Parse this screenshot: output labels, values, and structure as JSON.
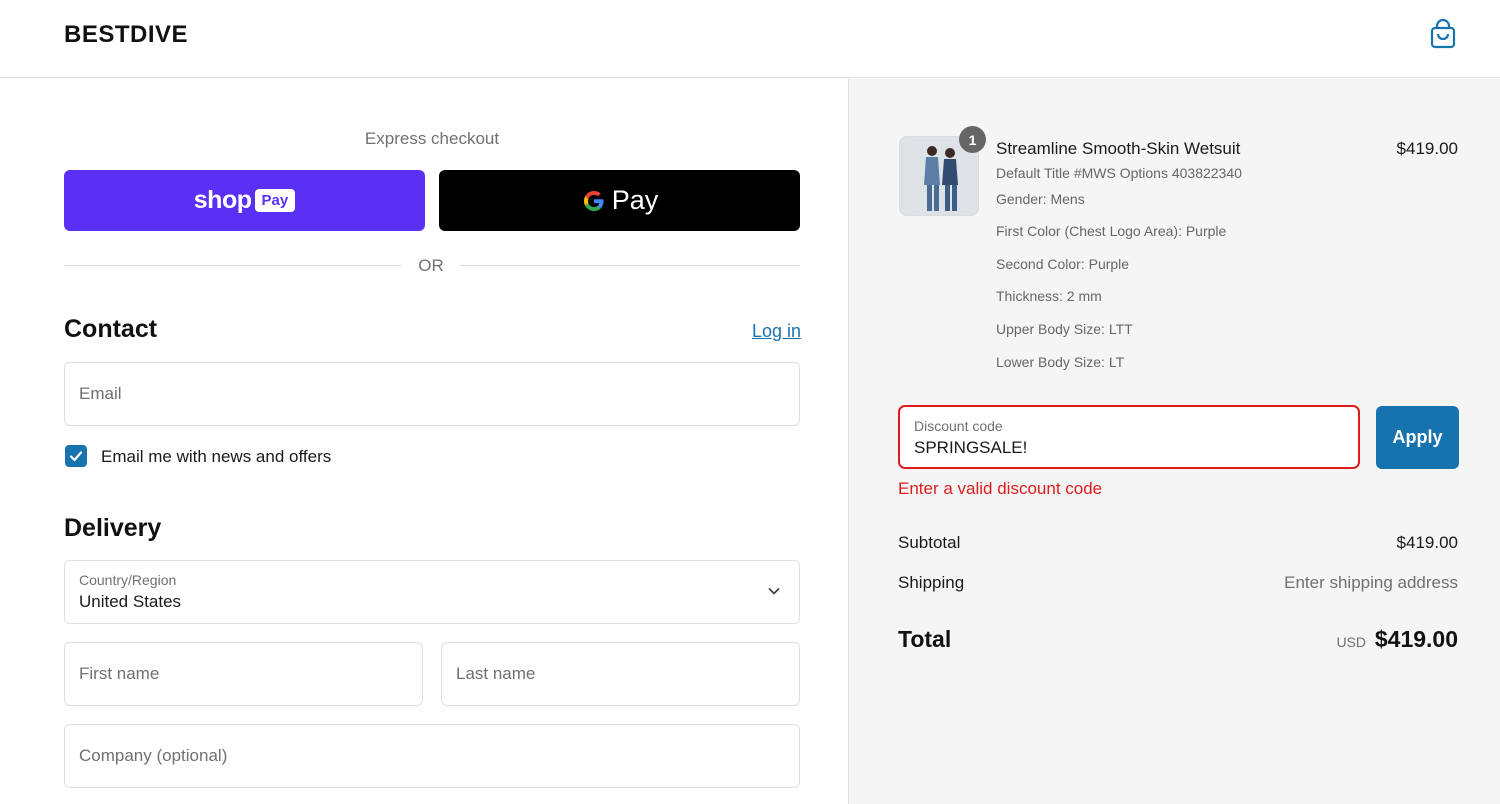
{
  "header": {
    "logo": "BESTDIVE",
    "cart_icon": "shopping-bag-icon"
  },
  "express": {
    "label": "Express checkout",
    "shop_pay_word": "shop",
    "shop_pay_badge": "Pay",
    "gpay_text": "Pay",
    "or": "OR"
  },
  "contact": {
    "title": "Contact",
    "login": "Log in",
    "email_placeholder": "Email",
    "newsletter_label": "Email me with news and offers",
    "newsletter_checked": true
  },
  "delivery": {
    "title": "Delivery",
    "country_label": "Country/Region",
    "country_value": "United States",
    "first_name_placeholder": "First name",
    "last_name_placeholder": "Last name",
    "company_placeholder": "Company (optional)"
  },
  "order": {
    "item": {
      "quantity": "1",
      "title": "Streamline Smooth-Skin Wetsuit",
      "price": "$419.00",
      "variant": "Default Title #MWS Options 403822340",
      "options": [
        "Gender: Mens",
        "First Color (Chest Logo Area): Purple",
        "Second Color: Purple",
        "Thickness: 2 mm",
        "Upper Body Size: LTT",
        "Lower Body Size: LT"
      ]
    },
    "discount": {
      "label": "Discount code",
      "value": "SPRINGSALE!",
      "apply": "Apply",
      "error": "Enter a valid discount code"
    },
    "subtotal_label": "Subtotal",
    "subtotal_value": "$419.00",
    "shipping_label": "Shipping",
    "shipping_value": "Enter shipping address",
    "total_label": "Total",
    "total_currency": "USD",
    "total_value": "$419.00"
  },
  "colors": {
    "accent": "#1773b0",
    "shop_pay": "#5a31f4",
    "error": "#dd1d1d"
  }
}
